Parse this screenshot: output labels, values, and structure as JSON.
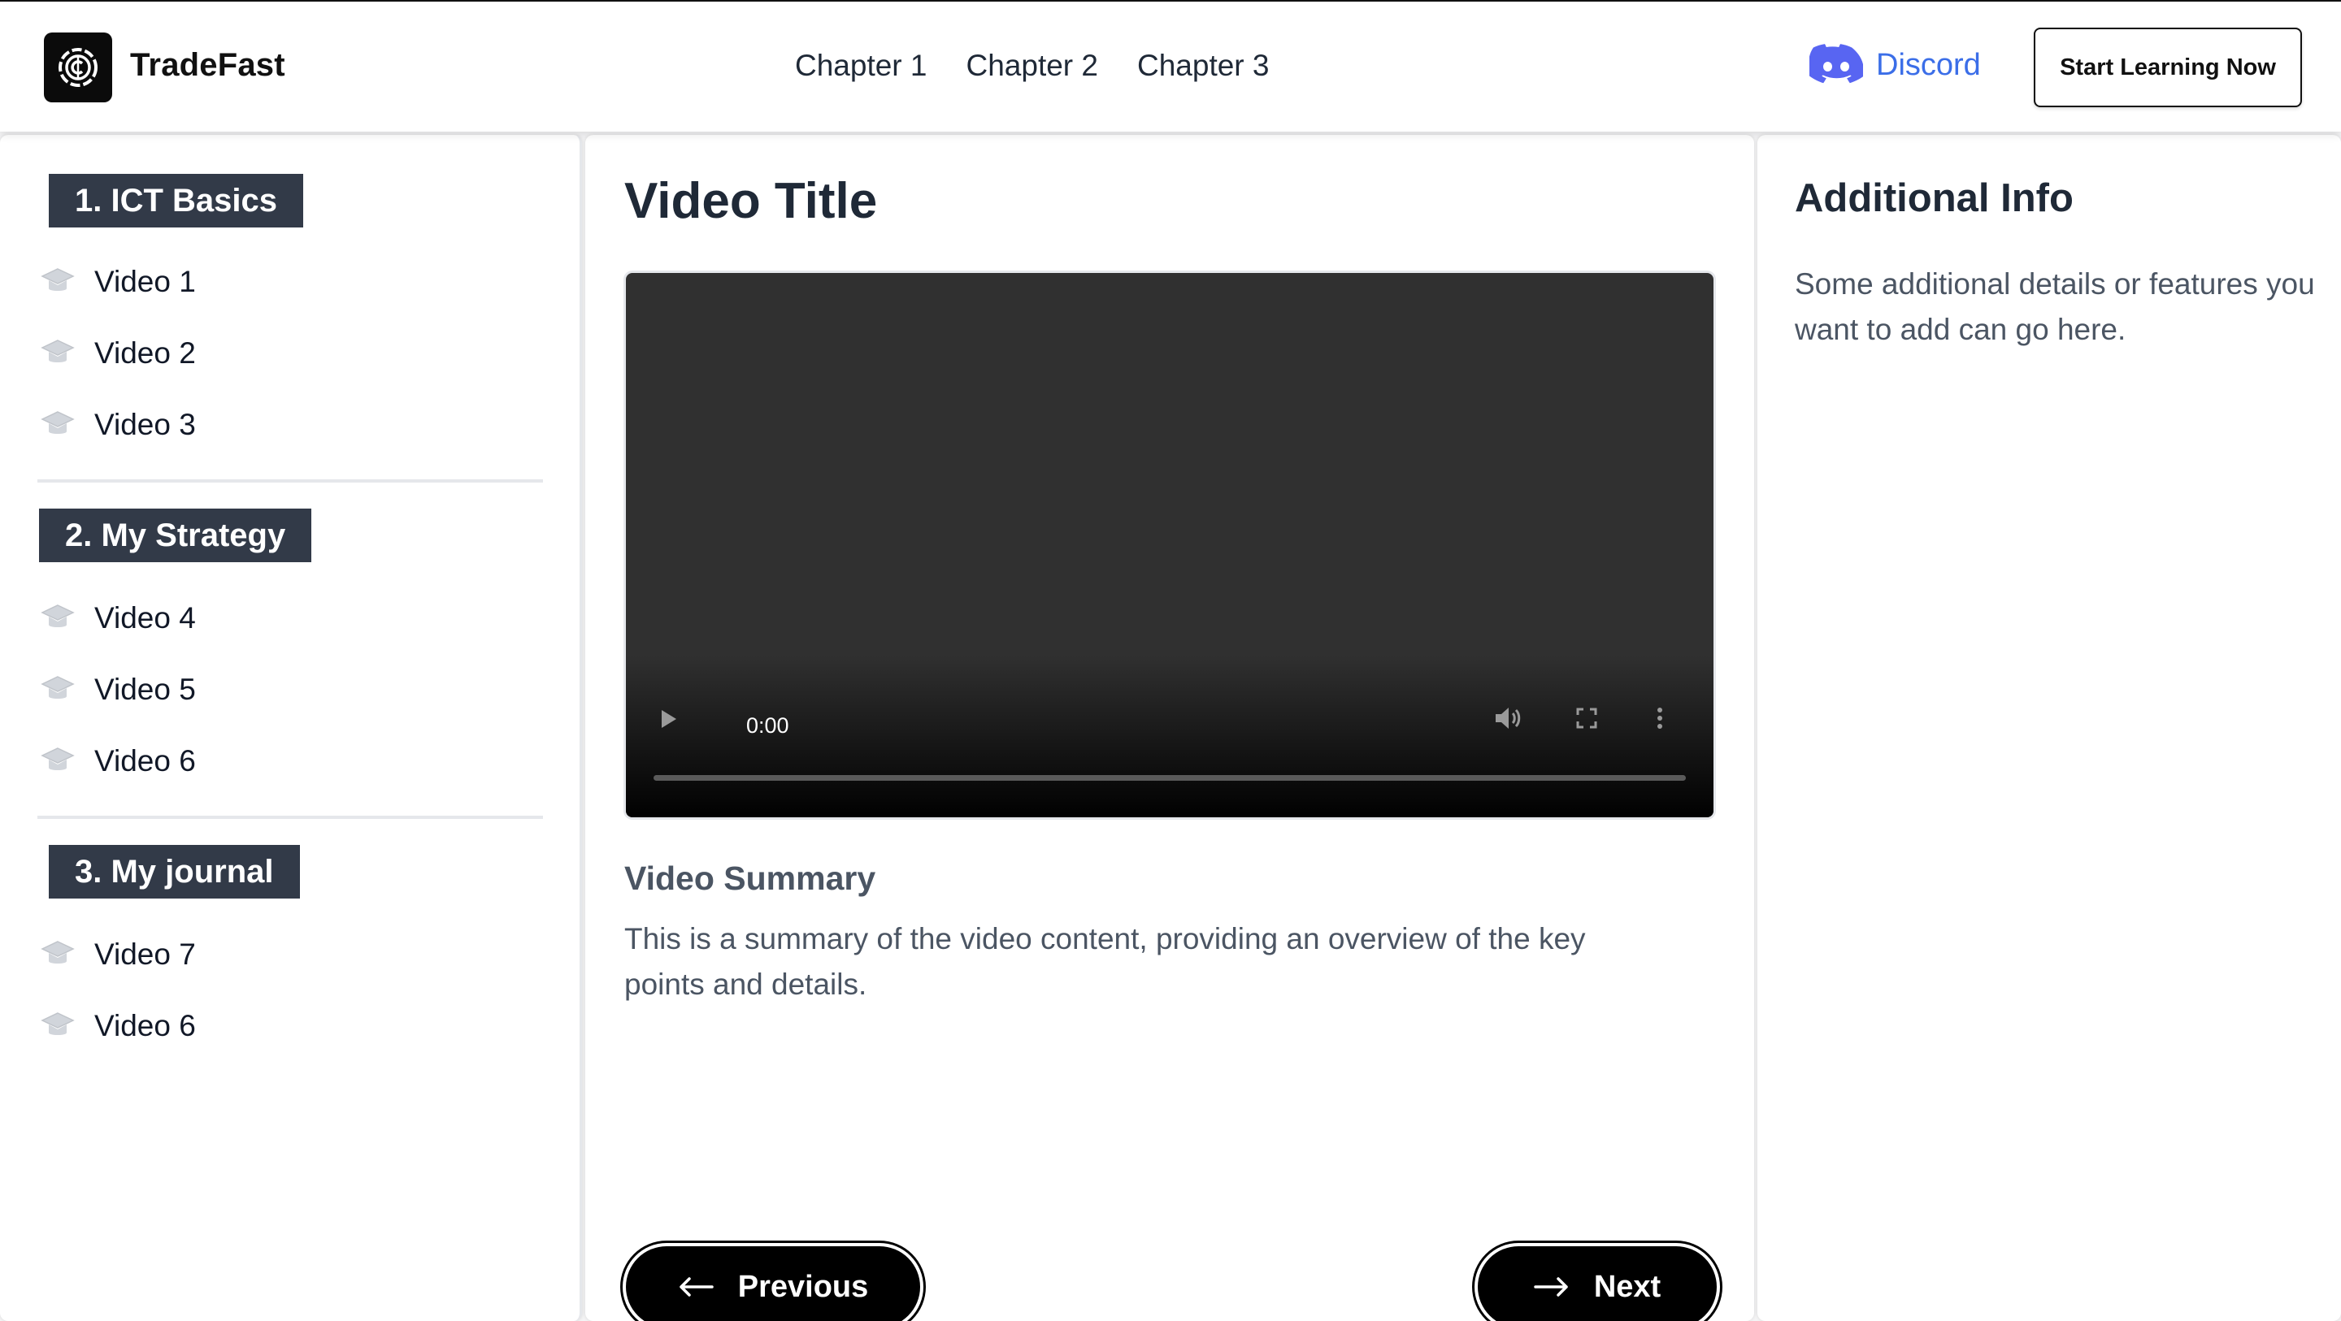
{
  "header": {
    "brand": "TradeFast",
    "logo_icon": "copyright-circle-icon",
    "nav": [
      "Chapter 1",
      "Chapter 2",
      "Chapter 3"
    ],
    "discord_label": "Discord",
    "discord_color": "#5865F2",
    "cta_label": "Start Learning Now"
  },
  "sidebar": {
    "sections": [
      {
        "title": "1. ICT Basics",
        "videos": [
          "Video 1",
          "Video 2",
          "Video 3"
        ]
      },
      {
        "title": "2. My Strategy",
        "videos": [
          "Video 4",
          "Video 5",
          "Video 6"
        ]
      },
      {
        "title": "3. My journal",
        "videos": [
          "Video 7",
          "Video 6"
        ]
      }
    ],
    "item_icon": "graduation-cap-icon",
    "tag_color": "#323a48"
  },
  "main": {
    "title": "Video Title",
    "player": {
      "time": "0:00",
      "progress": 0,
      "icons": [
        "play-icon",
        "volume-icon",
        "fullscreen-icon",
        "more-vertical-icon"
      ]
    },
    "summary_heading": "Video Summary",
    "summary_text": "This is a summary of the video content, providing an overview of the key points and details.",
    "prev_label": "Previous",
    "next_label": "Next"
  },
  "aside": {
    "heading": "Additional Info",
    "text": "Some additional details or features you want to add can go here."
  }
}
